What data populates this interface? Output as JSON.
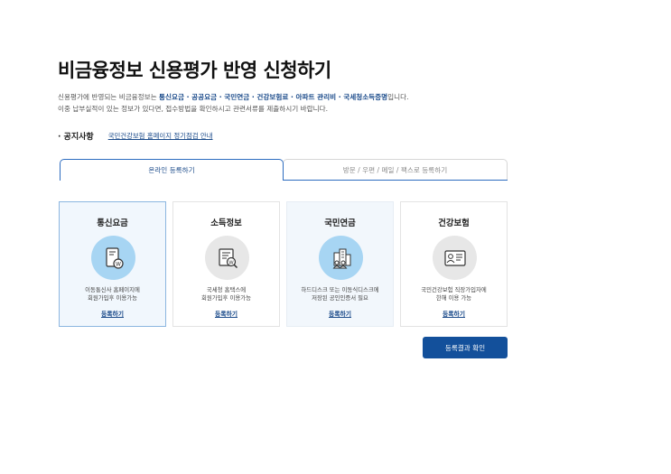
{
  "page": {
    "title": "비금융정보 신용평가 반영 신청하기",
    "desc_line1_prefix": "신용평가에 반영되는 비금융정보는 ",
    "desc_line1_highlight": "통신요금 · 공공요금 · 국민연금 · 건강보험료 · 아파트 관리비 · 국세청소득증명",
    "desc_line1_suffix": "입니다.",
    "desc_line2": "이중 납부실적이 있는 정보가 있다면, 접수방법을 확인하시고 관련서류를 제출하시기 바랍니다."
  },
  "notice": {
    "label": "· 공지사항",
    "link": "국민건강보험 홈페이지 정기점검 안내"
  },
  "tabs": [
    {
      "label": "온라인 등록하기",
      "active": true
    },
    {
      "label": "방문 / 우편 / 메일 / 팩스로 등록하기",
      "active": false
    }
  ],
  "cards": [
    {
      "title": "통신요금",
      "icon": "phone-document-icon",
      "desc": [
        "이동통신사 홈페이지에",
        "회원가입후 이용가능"
      ],
      "link": "등록하기"
    },
    {
      "title": "소득정보",
      "icon": "document-search-icon",
      "desc": [
        "국세청 홈택스에",
        "회원가입후 이용가능"
      ],
      "link": "등록하기"
    },
    {
      "title": "국민연금",
      "icon": "building-people-icon",
      "desc": [
        "하드디스크 또는 이동식디스크에",
        "저장된 공인인증서 필요"
      ],
      "link": "등록하기"
    },
    {
      "title": "건강보험",
      "icon": "id-card-icon",
      "desc": [
        "국민건강보험 직장가입자에",
        "한해 이용 가능"
      ],
      "link": "등록하기"
    }
  ],
  "result_button": "등록결과 확인",
  "colors": {
    "accent": "#13509b",
    "link": "#1a4a8a",
    "icon_blue": "#a7d5f3",
    "icon_gray": "#e7e7e7"
  }
}
